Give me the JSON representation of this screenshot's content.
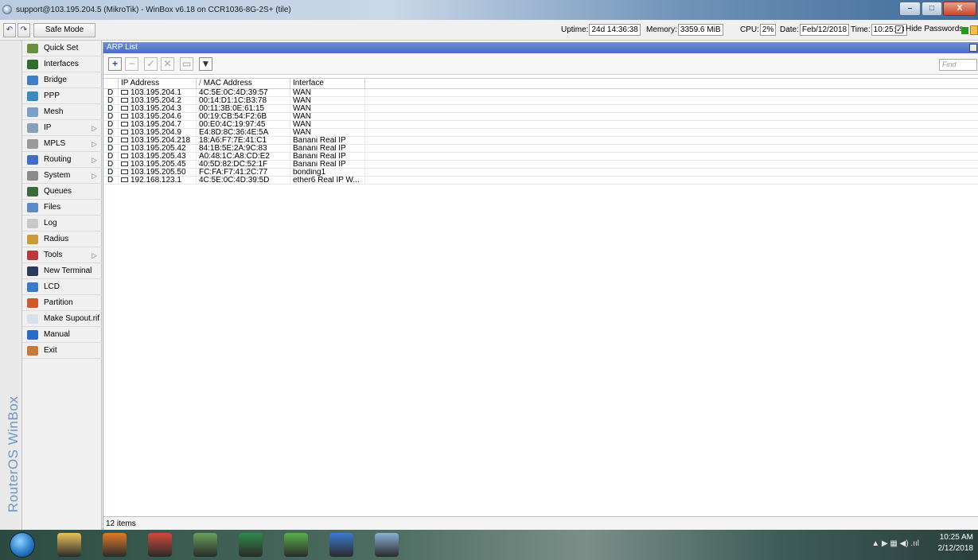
{
  "window": {
    "title": "support@103.195.204.5 (MikroTik) - WinBox v6.18 on CCR1036-8G-2S+ (tile)",
    "min_glyph": "–",
    "max_glyph": "□",
    "close_glyph": "X"
  },
  "toolbar": {
    "undo_glyph": "↶",
    "redo_glyph": "↷",
    "safe_mode_label": "Safe Mode",
    "uptime_label": "Uptime:",
    "uptime_value": "24d 14:36:38",
    "memory_label": "Memory:",
    "memory_value": "3359.6 MiB",
    "cpu_label": "CPU:",
    "cpu_value": "2%",
    "date_label": "Date:",
    "date_value": "Feb/12/2018",
    "time_label": "Time:",
    "time_value": "10:25:28",
    "hide_passwords_label": "Hide Passwords",
    "hide_passwords_checked": true
  },
  "brand": {
    "text": "RouterOS WinBox"
  },
  "sidebar": {
    "items": [
      {
        "label": "Quick Set",
        "icon": "quickset-icon",
        "color": "#6a8f3a",
        "submenu": false
      },
      {
        "label": "Interfaces",
        "icon": "interfaces-icon",
        "color": "#2f6a2f",
        "submenu": false
      },
      {
        "label": "Bridge",
        "icon": "bridge-icon",
        "color": "#3f7fc8",
        "submenu": false
      },
      {
        "label": "PPP",
        "icon": "ppp-icon",
        "color": "#3a8ac0",
        "submenu": false
      },
      {
        "label": "Mesh",
        "icon": "mesh-icon",
        "color": "#7aa0c8",
        "submenu": false
      },
      {
        "label": "IP",
        "icon": "ip-icon",
        "color": "#8aa0b8",
        "submenu": true
      },
      {
        "label": "MPLS",
        "icon": "mpls-icon",
        "color": "#9a9a9a",
        "submenu": true
      },
      {
        "label": "Routing",
        "icon": "routing-icon",
        "color": "#3f6fc8",
        "submenu": true
      },
      {
        "label": "System",
        "icon": "system-icon",
        "color": "#8a8a8a",
        "submenu": true
      },
      {
        "label": "Queues",
        "icon": "queues-icon",
        "color": "#3a6a3a",
        "submenu": false
      },
      {
        "label": "Files",
        "icon": "files-icon",
        "color": "#5a8ac8",
        "submenu": false
      },
      {
        "label": "Log",
        "icon": "log-icon",
        "color": "#c8c8c8",
        "submenu": false
      },
      {
        "label": "Radius",
        "icon": "radius-icon",
        "color": "#c89a3a",
        "submenu": false
      },
      {
        "label": "Tools",
        "icon": "tools-icon",
        "color": "#b83a3a",
        "submenu": true
      },
      {
        "label": "New Terminal",
        "icon": "terminal-icon",
        "color": "#2a3a5a",
        "submenu": false
      },
      {
        "label": "LCD",
        "icon": "lcd-icon",
        "color": "#3a7ac8",
        "submenu": false
      },
      {
        "label": "Partition",
        "icon": "partition-icon",
        "color": "#d05a2a",
        "submenu": false
      },
      {
        "label": "Make Supout.rif",
        "icon": "supout-icon",
        "color": "#d8e0ea",
        "submenu": false
      },
      {
        "label": "Manual",
        "icon": "manual-icon",
        "color": "#2a6ac8",
        "submenu": false
      },
      {
        "label": "Exit",
        "icon": "exit-icon",
        "color": "#c87a3a",
        "submenu": false
      }
    ],
    "submenu_glyph": "▷"
  },
  "arp": {
    "title": "ARP List",
    "find_placeholder": "Find",
    "buttons": {
      "add": "+",
      "remove": "−",
      "enable": "✓",
      "disable": "✕",
      "comment": "▭",
      "filter": "▼"
    },
    "columns": {
      "ip": "IP Address",
      "mac": "MAC Address",
      "interface": "Interface",
      "sort_mark": "/"
    },
    "rows": [
      {
        "flag": "D",
        "ip": "103.195.204.1",
        "mac": "4C:5E:0C:4D:39:57",
        "interface": "WAN"
      },
      {
        "flag": "D",
        "ip": "103.195.204.2",
        "mac": "00:14:D1:1C:B3:78",
        "interface": "WAN"
      },
      {
        "flag": "D",
        "ip": "103.195.204.3",
        "mac": "00:11:3B:0E:61:15",
        "interface": "WAN"
      },
      {
        "flag": "D",
        "ip": "103.195.204.6",
        "mac": "00:19:CB:54:F2:6B",
        "interface": "WAN"
      },
      {
        "flag": "D",
        "ip": "103.195.204.7",
        "mac": "00:E0:4C:19:97:45",
        "interface": "WAN"
      },
      {
        "flag": "D",
        "ip": "103.195.204.9",
        "mac": "E4:8D:8C:36:4E:5A",
        "interface": "WAN"
      },
      {
        "flag": "D",
        "ip": "103.195.204.218",
        "mac": "18:A6:F7:7E:41:C1",
        "interface": "Banani Real IP"
      },
      {
        "flag": "D",
        "ip": "103.195.205.42",
        "mac": "84:1B:5E:2A:9C:83",
        "interface": "Banani Real IP"
      },
      {
        "flag": "D",
        "ip": "103.195.205.43",
        "mac": "A0:48:1C:A8:CD:E2",
        "interface": "Banani Real IP"
      },
      {
        "flag": "D",
        "ip": "103.195.205.45",
        "mac": "40:5D:82:DC:52:1F",
        "interface": "Banani Real IP"
      },
      {
        "flag": "D",
        "ip": "103.195.205.50",
        "mac": "FC:FA:F7:41:2C:77",
        "interface": "bonding1"
      },
      {
        "flag": "D",
        "ip": "192.168.123.1",
        "mac": "4C:5E:0C:4D:39:5D",
        "interface": "ether6 Real IP W..."
      }
    ],
    "status": "12 items"
  },
  "taskbar": {
    "apps": [
      {
        "icon": "explorer-icon",
        "color": "#e8c25a"
      },
      {
        "icon": "outlook-icon",
        "color": "#e07a2a"
      },
      {
        "icon": "chrome-icon",
        "color": "#d04a3a"
      },
      {
        "icon": "notepad-icon",
        "color": "#6aa05a"
      },
      {
        "icon": "excel-icon",
        "color": "#2f8a4a"
      },
      {
        "icon": "utorrent-icon",
        "color": "#5ab04a"
      },
      {
        "icon": "winbox-icon",
        "color": "#3a7ad0"
      },
      {
        "icon": "paint-icon",
        "color": "#8ab0d8"
      }
    ],
    "clock_time": "10:25 AM",
    "clock_date": "2/12/2018",
    "tray_glyphs": "▲  ▶  ▦  ◀)  .ııl"
  }
}
